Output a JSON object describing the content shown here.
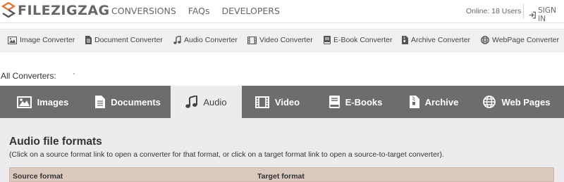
{
  "brand": {
    "name": "FILEZIGZAG",
    "accent": "#e8733a"
  },
  "header": {
    "nav": [
      "CONVERSIONS",
      "FAQs",
      "DEVELOPERS"
    ],
    "online": "Online: 18 Users",
    "signin": "SIGN IN"
  },
  "categories": [
    {
      "label": "Image Converter",
      "icon": "image-icon"
    },
    {
      "label": "Document Converter",
      "icon": "document-icon"
    },
    {
      "label": "Audio Converter",
      "icon": "music-icon"
    },
    {
      "label": "Video Converter",
      "icon": "film-icon"
    },
    {
      "label": "E-Book Converter",
      "icon": "book-icon"
    },
    {
      "label": "Archive Converter",
      "icon": "archive-icon"
    },
    {
      "label": "WebPage Converter",
      "icon": "globe-icon"
    }
  ],
  "all_converters_label": "All Converters:",
  "tabs": [
    {
      "label": "Images",
      "icon": "image-icon",
      "active": false
    },
    {
      "label": "Documents",
      "icon": "document-icon",
      "active": false
    },
    {
      "label": "Audio",
      "icon": "music-icon",
      "active": true
    },
    {
      "label": "Video",
      "icon": "film-icon",
      "active": false
    },
    {
      "label": "E-Books",
      "icon": "book-icon",
      "active": false
    },
    {
      "label": "Archive",
      "icon": "archive-icon",
      "active": false
    },
    {
      "label": "Web Pages",
      "icon": "globe-icon",
      "active": false
    }
  ],
  "section": {
    "title": "Audio file formats",
    "instructions": "(Click on a source format link to open a converter for that format, or click on a target format link to open a source-to-target converter).",
    "columns": [
      "Source format",
      "Target format"
    ]
  }
}
